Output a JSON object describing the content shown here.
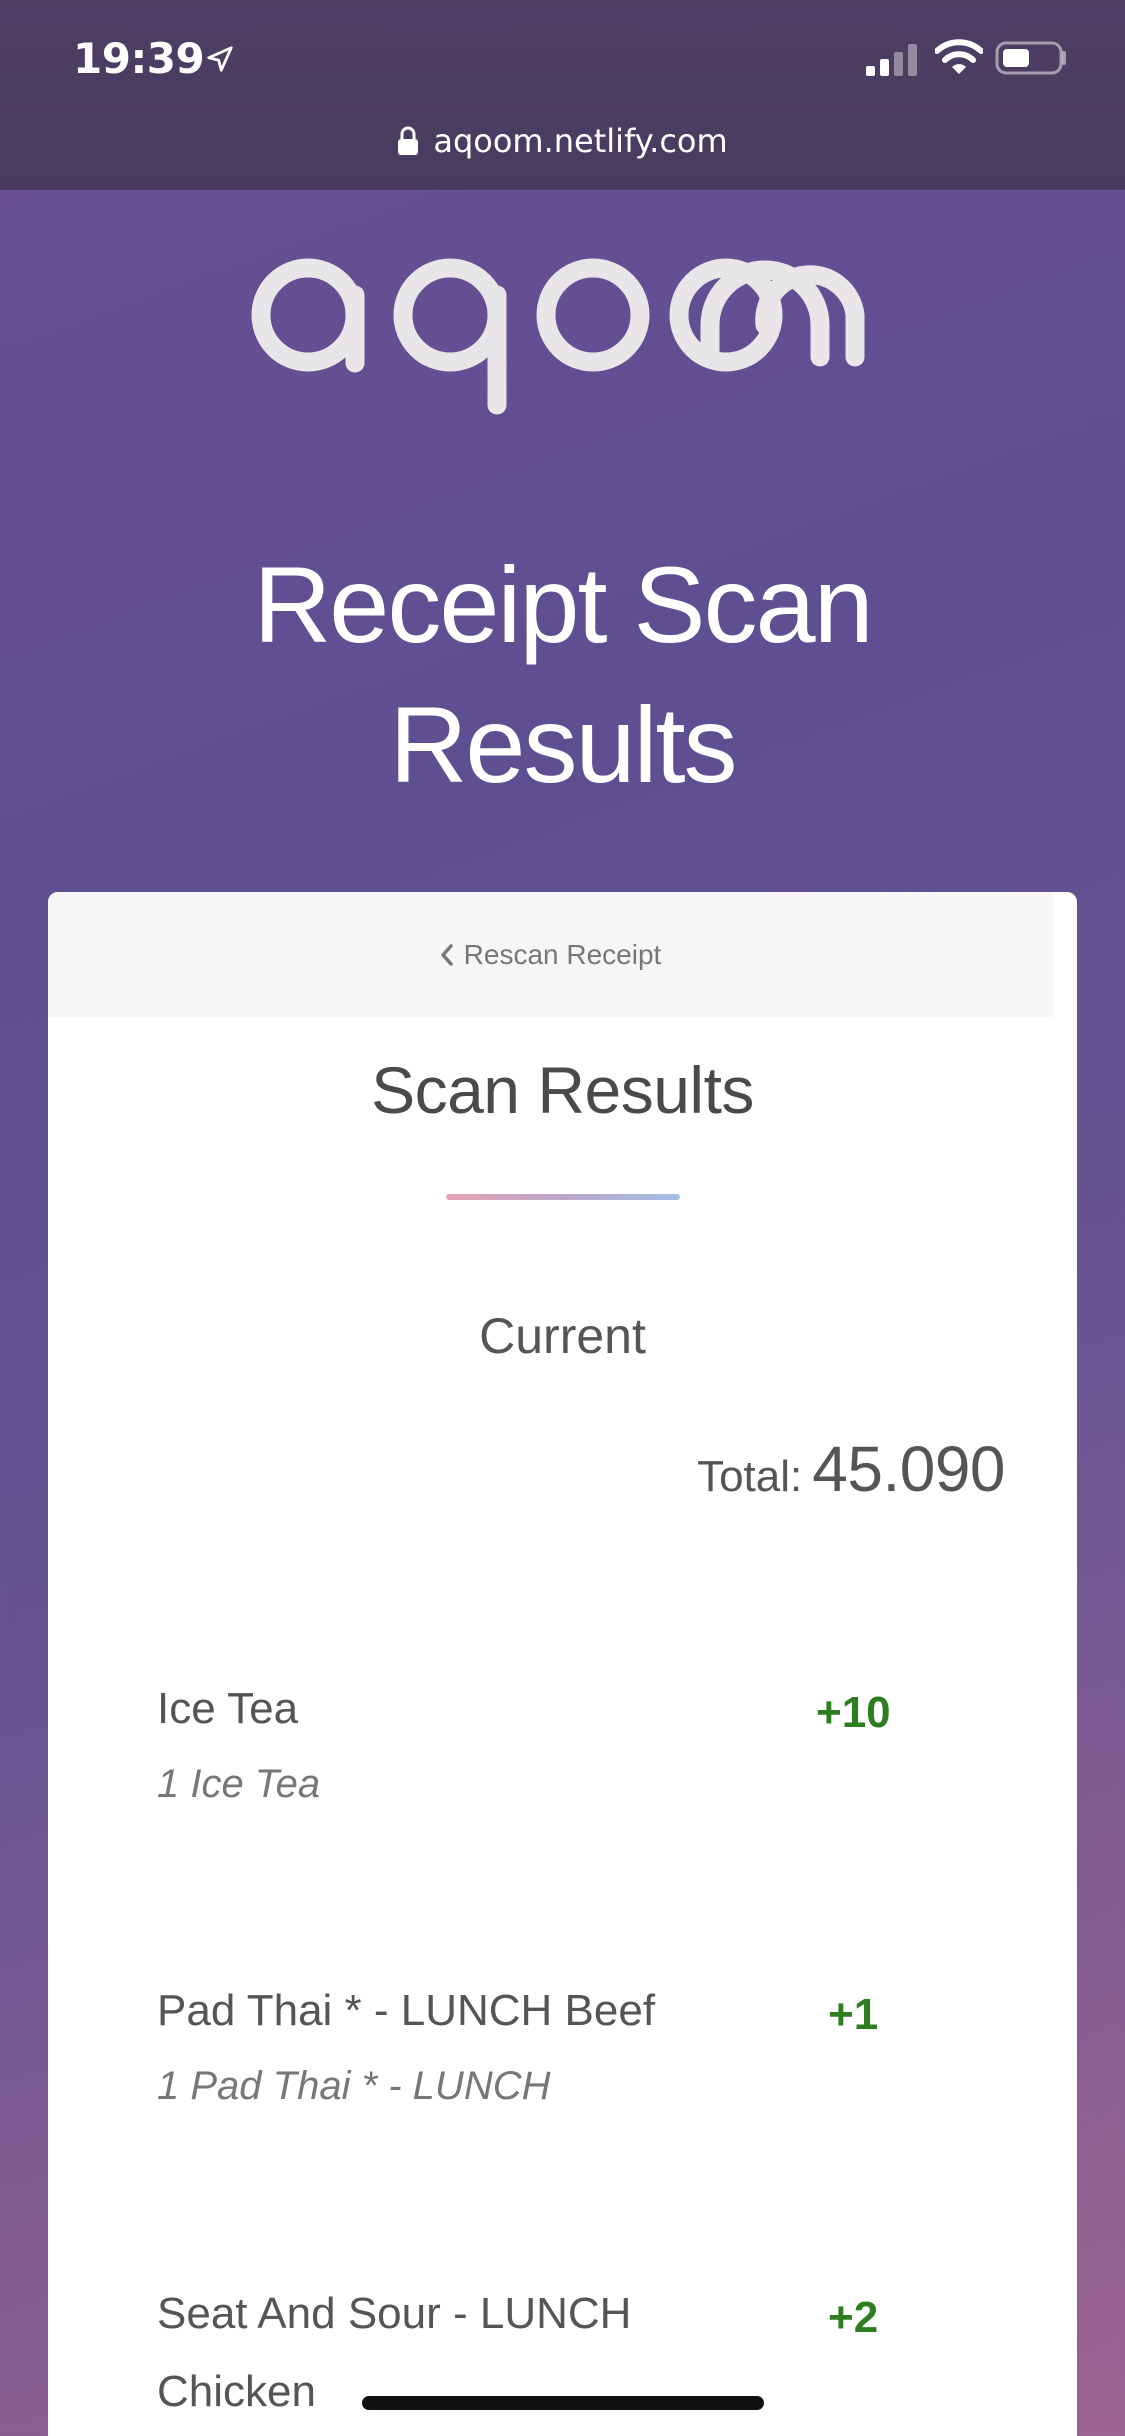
{
  "status_bar": {
    "time": "19:39"
  },
  "browser": {
    "url": "aqoom.netlify.com"
  },
  "logo": {
    "text": "aqoom"
  },
  "page": {
    "title_line1": "Receipt Scan",
    "title_line2": "Results"
  },
  "card": {
    "rescan_label": "Rescan Receipt",
    "heading": "Scan Results",
    "current_label": "Current",
    "total_label": "Total:",
    "total_value": "45.090",
    "items": [
      {
        "name": "Ice Tea",
        "detail": "1 Ice Tea",
        "points": "+10"
      },
      {
        "name": "Pad Thai * - LUNCH Beef",
        "detail": "1 Pad Thai * - LUNCH",
        "points": "+1"
      },
      {
        "name_line1": "Seat And Sour - LUNCH",
        "name_line2": "Chicken",
        "points": "+2"
      }
    ]
  },
  "colors": {
    "background_top": "#5d4f92",
    "background_bottom": "#9c6490",
    "points_green": "#2e7d20",
    "card_header": "#f6f6f6"
  },
  "icons": {
    "location": "location-arrow-icon",
    "signal": "cellular-signal-icon",
    "wifi": "wifi-icon",
    "battery": "battery-icon",
    "lock": "lock-icon",
    "back": "chevron-left-icon"
  }
}
